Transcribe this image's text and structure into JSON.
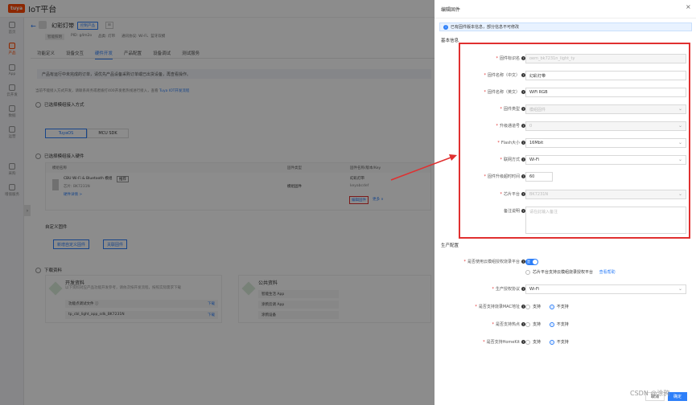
{
  "topbar": {
    "logo": "tuya",
    "brand": "IoT平台"
  },
  "sidebar": {
    "items": [
      {
        "label": "首页",
        "icon": "home-icon"
      },
      {
        "label": "产品",
        "icon": "product-icon",
        "active": true
      },
      {
        "label": "App",
        "icon": "app-icon"
      },
      {
        "label": "云开发",
        "icon": "cloud-icon"
      },
      {
        "label": "数据",
        "icon": "data-icon"
      },
      {
        "label": "运营",
        "icon": "operation-icon"
      },
      {
        "label": "采购",
        "icon": "purchase-icon"
      },
      {
        "label": "增值服务",
        "icon": "service-icon"
      }
    ],
    "toggle": "›"
  },
  "product": {
    "back": "←",
    "name": "幻彩灯带",
    "tag": "控制产品",
    "tag2": "⊞",
    "meta": [
      "智能照明",
      "PID: g4m2o",
      "品类: 灯带",
      "通讯协议: Wi-Fi、蓝牙双模"
    ],
    "tabs": [
      "功能定义",
      "设备交互",
      "硬件开发",
      "产品配置",
      "设备调试",
      "测试服务"
    ],
    "active_tab": "硬件开发"
  },
  "main": {
    "notice": "产品有运行中未完成的订单，请优先产品设备采购订单或已出货设备，再查看操作。",
    "hint_text": "当前不能接入方式开发，请联系商务或者拨打400开发者热线进行接入，查看",
    "hint_link": "Tuya IOT开发流程",
    "step1": "已选择模组接入方式",
    "seg": [
      "TuyaOS",
      "MCU SDK"
    ],
    "step2": "已选择模组接入硬件",
    "table_headers": [
      "模组名称",
      "固件类型",
      "固件名称/版本/Key"
    ],
    "module_name": "CBU Wi-Fi & Bluetooth 模组",
    "module_tag": "推荐",
    "module_chip": "芯片: BK7231N",
    "module_link": "硬件详情 >",
    "fw_type": "模组固件",
    "fw_name": "幻彩灯带",
    "fw_key": "keyabcdef",
    "edit_fw": "编辑固件",
    "more": "更多 ∨",
    "custom_title": "自定义固件",
    "btn_new": "新增自定义固件",
    "btn_link": "关联固件",
    "step3": "下载资料",
    "dev_docs_title": "开发资料",
    "dev_docs_sub": "以下资料对应产品功能开发参考，请依次按开发流程，按照实际需求下载",
    "dev_rows": [
      "功能点调试文件 ⓘ",
      "tp_cbl_light_app_sdk_BK7231N"
    ],
    "download": "下载",
    "pub_title": "公共资料",
    "pub_rows": [
      "智能生活 App",
      "涂鸦云调 App",
      "涂鸦设备"
    ]
  },
  "drawer": {
    "title": "编辑固件",
    "close": "×",
    "info": "已有固件版本信息，部分信息不可修改",
    "basic_section": "基本信息",
    "fields": [
      {
        "label": "固件标识名",
        "required": true,
        "value": "oem_bk7231n_light_ty",
        "disabled": true,
        "kind": "input"
      },
      {
        "label": "固件名称（中文）",
        "required": true,
        "value": "幻彩灯带",
        "disabled": false,
        "kind": "input"
      },
      {
        "label": "固件名称（英文）",
        "required": true,
        "value": "WiFi RGB",
        "disabled": false,
        "kind": "input"
      },
      {
        "label": "固件类型",
        "required": true,
        "value": "模组固件",
        "disabled": true,
        "kind": "select"
      },
      {
        "label": "升级通道号",
        "required": true,
        "value": "0",
        "disabled": true,
        "kind": "select"
      },
      {
        "label": "Flash大小",
        "required": true,
        "value": "16Mbit",
        "disabled": false,
        "kind": "select"
      },
      {
        "label": "联网方式",
        "required": true,
        "value": "Wi-Fi",
        "disabled": false,
        "kind": "select"
      },
      {
        "label": "固件升级超时时间",
        "required": true,
        "value": "60",
        "disabled": false,
        "kind": "short"
      },
      {
        "label": "芯片平台",
        "required": true,
        "value": "BK7231N",
        "disabled": true,
        "kind": "select"
      },
      {
        "label": "备注说明",
        "required": false,
        "value": "请在此输入备注",
        "disabled": false,
        "kind": "textarea"
      }
    ],
    "prod_section": "生产配置",
    "auth_label": "是否使用云模组授权烧录平台",
    "auth_toggle": "是",
    "auth_check": "芯片平台支持云模组烧录授权平台",
    "auth_link": "查看帮助",
    "prod_auth_label": "生产授权协议",
    "prod_auth_value": "Wi-Fi",
    "mac_label": "是否支持烧录MAC地址",
    "hotspot_label": "是否支持热点",
    "homekit_label": "是否支持HomeKit",
    "yes": "支持",
    "no": "不支持",
    "cancel": "取消",
    "ok": "确定"
  },
  "watermark": "CSDN @涂鸦",
  "colors": {
    "accent": "#2d7ff9",
    "brand": "#ff4800",
    "annotation": "#e03030"
  }
}
